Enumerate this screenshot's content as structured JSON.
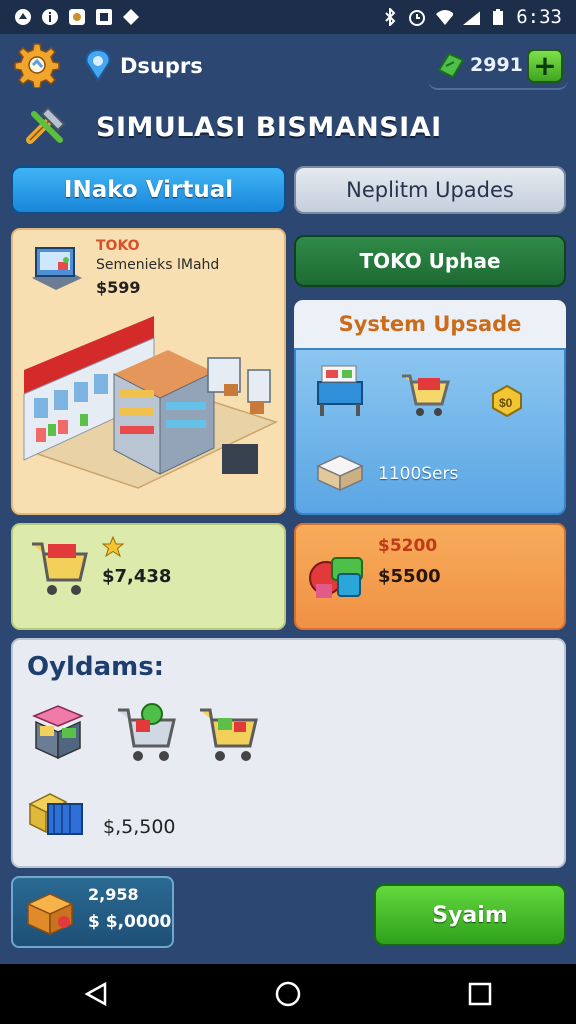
{
  "status_bar": {
    "time": "6:33",
    "left_icons": [
      "notification-icon",
      "info-icon",
      "app-icon",
      "app-icon",
      "diamond-icon"
    ],
    "right_icons": [
      "bluetooth-icon",
      "alarm-icon",
      "wifi-icon",
      "signal-icon",
      "battery-icon"
    ]
  },
  "header": {
    "username": "Dsuprs",
    "coins": "2991",
    "plus_label": "+",
    "title": "SIMULASI BISMANSIAI"
  },
  "tabs": [
    {
      "label": "INako Virtual",
      "active": true
    },
    {
      "label": "Neplitm Upades",
      "active": false
    }
  ],
  "toko_card": {
    "label": "TOKO",
    "subtitle": "Semenieks lMahd",
    "price": "$599"
  },
  "upgrade_button": {
    "label": "TOKO Uphae"
  },
  "system": {
    "title": "System Upsade",
    "count_text": "1100Sers"
  },
  "cards": {
    "cart_value": "$7,438",
    "orange_top": "$5200",
    "orange_value": "$5500"
  },
  "panel": {
    "title": "Oyldams:",
    "price": "$,5,500"
  },
  "footer": {
    "money_line1": "2,958",
    "money_line2": "$ $,0000",
    "button_label": "Syaim"
  },
  "colors": {
    "background": "#2c4772",
    "tab_active": "#1a86d9",
    "upgrade_green": "#1d6a33",
    "primary_green": "#2ea11c",
    "orange_card": "#f09145"
  }
}
